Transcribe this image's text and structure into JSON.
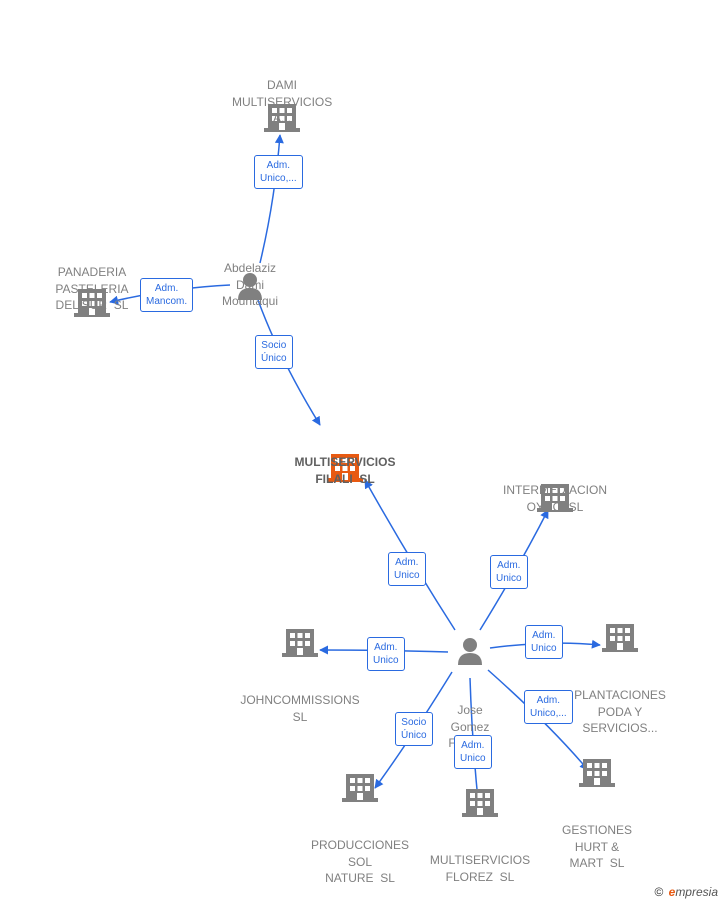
{
  "colors": {
    "edge": "#2a6ae0",
    "node_icon": "#808080",
    "central_icon": "#e85a12",
    "text": "#808080"
  },
  "people": {
    "abdelaziz": {
      "name": "Abdelaziz\nDami\nMountaqui"
    },
    "jose": {
      "name": "Jose\nGomez\nFuentes"
    }
  },
  "companies": {
    "dami": {
      "name": "DAMI\nMULTISERVICIOS\nA..."
    },
    "panaderia": {
      "name": "PANADERIA\nPASTELERIA\nDEL SUR  SL"
    },
    "multiservicios_filali": {
      "name": "MULTISERVICIOS\nFILALI  SL"
    },
    "intermediacion": {
      "name": "INTERMEDIACION\nOYCO  SL"
    },
    "plantaciones": {
      "name": "PLANTACIONES\nPODA Y\nSERVICIOS..."
    },
    "johncommissions": {
      "name": "JOHNCOMMISSIONS\nSL"
    },
    "producciones": {
      "name": "PRODUCCIONES\nSOL\nNATURE  SL"
    },
    "multiservicios_florez": {
      "name": "MULTISERVICIOS\nFLOREZ  SL"
    },
    "gestiones": {
      "name": "GESTIONES\nHURT &\nMART  SL"
    }
  },
  "edges": {
    "abdelaziz_dami": {
      "label": "Adm.\nUnico,..."
    },
    "abdelaziz_panaderia": {
      "label": "Adm.\nMancom."
    },
    "abdelaziz_filali": {
      "label": "Socio\nÚnico"
    },
    "jose_filali": {
      "label": "Adm.\nUnico"
    },
    "jose_intermediacion": {
      "label": "Adm.\nUnico"
    },
    "jose_plantaciones": {
      "label": "Adm.\nUnico"
    },
    "jose_john": {
      "label": "Adm.\nUnico"
    },
    "jose_producciones": {
      "label": "Socio\nÚnico"
    },
    "jose_florez": {
      "label": "Adm.\nUnico"
    },
    "jose_gestiones": {
      "label": "Adm.\nUnico,..."
    }
  },
  "copyright": "mpresia"
}
